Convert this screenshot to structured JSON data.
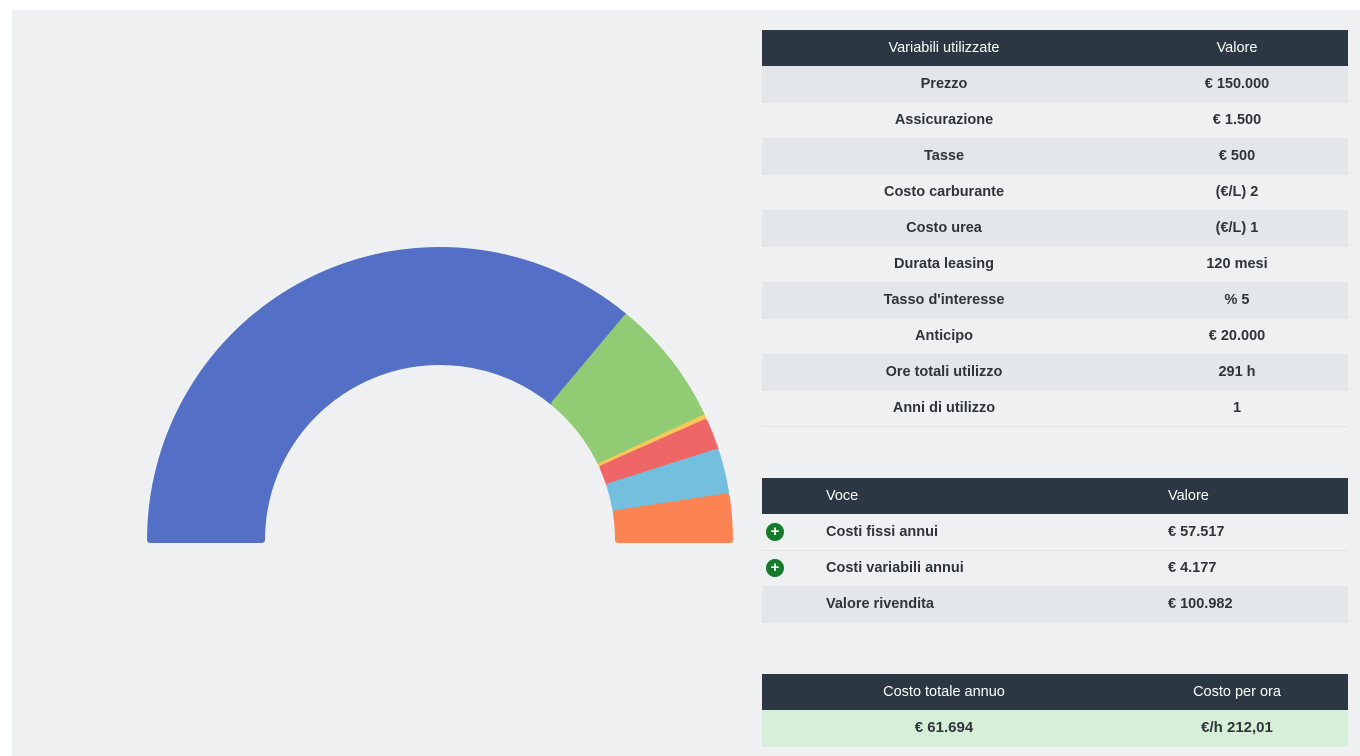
{
  "colors": {
    "header_bg": "#2b3844",
    "segment_main": "#5470c6",
    "segment_green": "#91cc75",
    "segment_yellow": "#fac858",
    "segment_red": "#ee6666",
    "segment_cyan": "#73c0de",
    "segment_orange": "#fc8452",
    "total_row_bg": "#d6efd9",
    "plus_icon": "#157a2c"
  },
  "gauge": {
    "segments": [
      {
        "name": "main",
        "color": "#5470c6",
        "share": 0.72
      },
      {
        "name": "green",
        "color": "#91cc75",
        "share": 0.14
      },
      {
        "name": "yellow",
        "color": "#fac858",
        "share": 0.005
      },
      {
        "name": "red",
        "color": "#ee6666",
        "share": 0.035
      },
      {
        "name": "cyan",
        "color": "#73c0de",
        "share": 0.05
      },
      {
        "name": "orange",
        "color": "#fc8452",
        "share": 0.05
      }
    ]
  },
  "variables_table": {
    "headers": [
      "Variabili utilizzate",
      "Valore"
    ],
    "rows": [
      {
        "label": "Prezzo",
        "value": "€ 150.000"
      },
      {
        "label": "Assicurazione",
        "value": "€ 1.500"
      },
      {
        "label": "Tasse",
        "value": "€ 500"
      },
      {
        "label": "Costo carburante",
        "value": "(€/L)  2"
      },
      {
        "label": "Costo urea",
        "value": "(€/L) 1"
      },
      {
        "label": "Durata leasing",
        "value": "120 mesi"
      },
      {
        "label": "Tasso d'interesse",
        "value": "% 5"
      },
      {
        "label": "Anticipo",
        "value": "€ 20.000"
      },
      {
        "label": "Ore totali utilizzo",
        "value": "291 h"
      },
      {
        "label": "Anni di utilizzo",
        "value": "1"
      }
    ]
  },
  "cost_table": {
    "headers": [
      "Voce",
      "Valore"
    ],
    "rows": [
      {
        "label": "Costi fissi annui",
        "value": "€ 57.517",
        "icon": "plus-circle-icon"
      },
      {
        "label": "Costi variabili annui",
        "value": "€ 4.177",
        "icon": "plus-circle-icon"
      },
      {
        "label": "Valore rivendita",
        "value": "€ 100.982",
        "icon": ""
      }
    ],
    "plus_glyph": "+"
  },
  "total_table": {
    "headers": [
      "Costo totale annuo",
      "Costo per ora"
    ],
    "total_annual": "€ 61.694",
    "cost_per_hour": "€/h 212,01"
  }
}
